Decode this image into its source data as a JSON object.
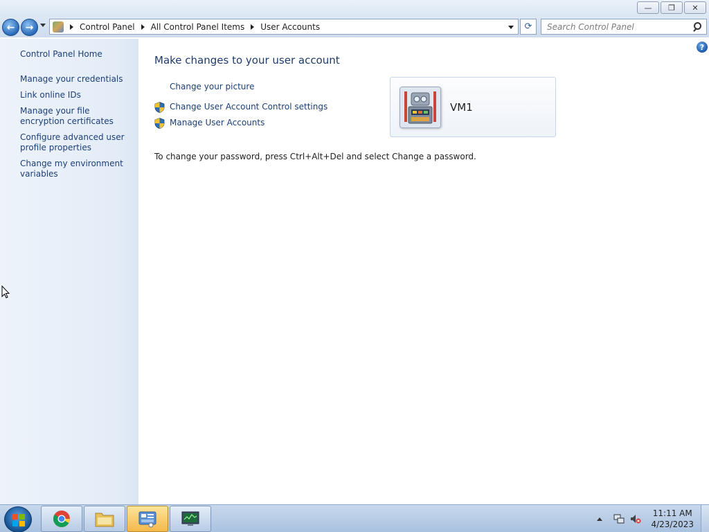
{
  "window": {
    "caption_buttons": {
      "minimize": "—",
      "restore": "❐",
      "close": "✕"
    }
  },
  "navbar": {
    "back_icon": "back-arrow-icon",
    "forward_icon": "forward-arrow-icon",
    "breadcrumbs": [
      "Control Panel",
      "All Control Panel Items",
      "User Accounts"
    ],
    "refresh_icon": "refresh-icon",
    "search_placeholder": "Search Control Panel"
  },
  "sidebar": {
    "items": [
      {
        "label": "Control Panel Home"
      },
      {
        "label": "Manage your credentials"
      },
      {
        "label": "Link online IDs"
      },
      {
        "label": "Manage your file encryption certificates"
      },
      {
        "label": "Configure advanced user profile properties"
      },
      {
        "label": "Change my environment variables"
      }
    ]
  },
  "main": {
    "title": "Make changes to your user account",
    "tasks": [
      {
        "label": "Change your picture",
        "icon": ""
      },
      {
        "label": "Change User Account Control settings",
        "icon": "uac-shield-icon"
      },
      {
        "label": "Manage User Accounts",
        "icon": "uac-shield-icon"
      }
    ],
    "password_note": "To change your password, press Ctrl+Alt+Del and select Change a password.",
    "user": {
      "name": "VM1",
      "picture_icon": "robot-avatar-icon"
    },
    "help_icon": "?"
  },
  "taskbar": {
    "apps": [
      {
        "name": "Google Chrome",
        "icon": "chrome-icon"
      },
      {
        "name": "Windows Explorer",
        "icon": "folder-icon"
      },
      {
        "name": "Control Panel",
        "icon": "control-panel-icon",
        "active": true
      },
      {
        "name": "Monitor",
        "icon": "monitor-icon"
      }
    ],
    "clock": {
      "time": "11:11 AM",
      "date": "4/23/2023"
    }
  },
  "colors": {
    "link": "#1c3f77",
    "title": "#1e3b6b",
    "sidebar": "#e3ecf7"
  }
}
